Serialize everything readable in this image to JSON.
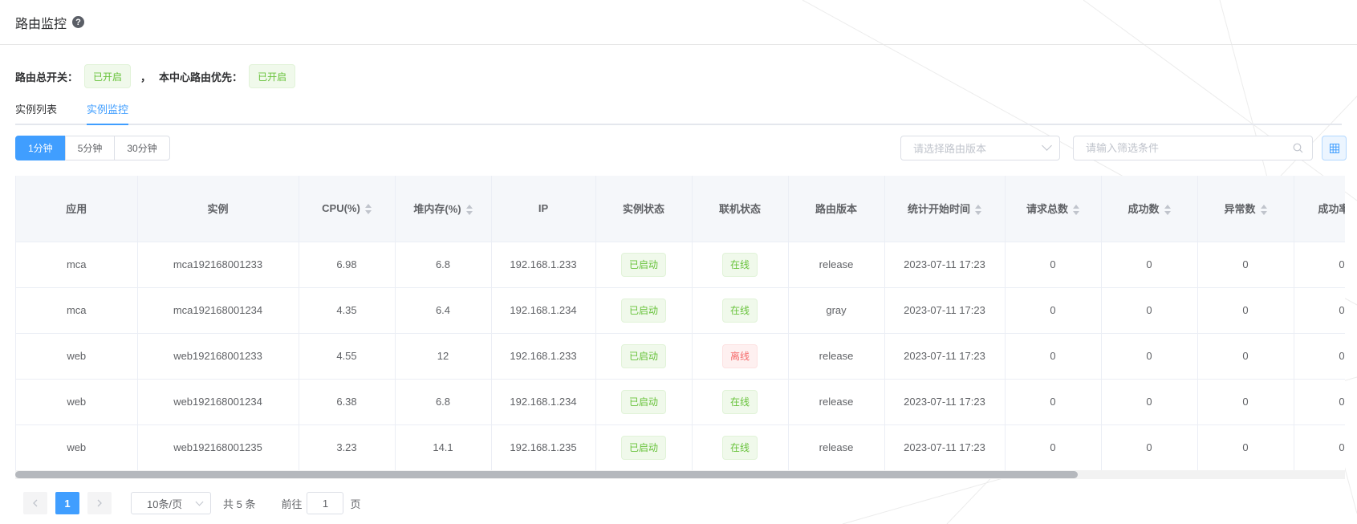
{
  "header": {
    "title": "路由监控",
    "help_icon": "question-circle-icon"
  },
  "switches": {
    "master_label": "路由总开关：",
    "master_value": "已开启",
    "separator": "，",
    "priority_label": "本中心路由优先：",
    "priority_value": "已开启"
  },
  "tabs": [
    {
      "label": "实例列表",
      "active": false
    },
    {
      "label": "实例监控",
      "active": true
    }
  ],
  "time_buttons": [
    {
      "label": "1分钟",
      "active": true
    },
    {
      "label": "5分钟",
      "active": false
    },
    {
      "label": "30分钟",
      "active": false
    }
  ],
  "filters": {
    "version_placeholder": "请选择路由版本",
    "search_placeholder": "请输入筛选条件"
  },
  "table": {
    "columns": [
      {
        "label": "应用",
        "sortable": false
      },
      {
        "label": "实例",
        "sortable": false
      },
      {
        "label": "CPU(%)",
        "sortable": true
      },
      {
        "label": "堆内存(%)",
        "sortable": true
      },
      {
        "label": "IP",
        "sortable": false
      },
      {
        "label": "实例状态",
        "sortable": false
      },
      {
        "label": "联机状态",
        "sortable": false
      },
      {
        "label": "路由版本",
        "sortable": false
      },
      {
        "label": "统计开始时间",
        "sortable": true
      },
      {
        "label": "请求总数",
        "sortable": true
      },
      {
        "label": "成功数",
        "sortable": true
      },
      {
        "label": "异常数",
        "sortable": true
      },
      {
        "label": "成功率(%)",
        "sortable": false
      }
    ],
    "rows": [
      {
        "app": "mca",
        "instance": "mca192168001233",
        "cpu": "6.98",
        "heap": "6.8",
        "ip": "192.168.1.233",
        "instance_status": "已启动",
        "online_status": "在线",
        "online_ok": true,
        "version": "release",
        "start_time": "2023-07-11 17:23",
        "total": "0",
        "success": "0",
        "error": "0",
        "rate": "0"
      },
      {
        "app": "mca",
        "instance": "mca192168001234",
        "cpu": "4.35",
        "heap": "6.4",
        "ip": "192.168.1.234",
        "instance_status": "已启动",
        "online_status": "在线",
        "online_ok": true,
        "version": "gray",
        "start_time": "2023-07-11 17:23",
        "total": "0",
        "success": "0",
        "error": "0",
        "rate": "0"
      },
      {
        "app": "web",
        "instance": "web192168001233",
        "cpu": "4.55",
        "heap": "12",
        "ip": "192.168.1.233",
        "instance_status": "已启动",
        "online_status": "离线",
        "online_ok": false,
        "version": "release",
        "start_time": "2023-07-11 17:23",
        "total": "0",
        "success": "0",
        "error": "0",
        "rate": "0"
      },
      {
        "app": "web",
        "instance": "web192168001234",
        "cpu": "6.38",
        "heap": "6.8",
        "ip": "192.168.1.234",
        "instance_status": "已启动",
        "online_status": "在线",
        "online_ok": true,
        "version": "release",
        "start_time": "2023-07-11 17:23",
        "total": "0",
        "success": "0",
        "error": "0",
        "rate": "0"
      },
      {
        "app": "web",
        "instance": "web192168001235",
        "cpu": "3.23",
        "heap": "14.1",
        "ip": "192.168.1.235",
        "instance_status": "已启动",
        "online_status": "在线",
        "online_ok": true,
        "version": "release",
        "start_time": "2023-07-11 17:23",
        "total": "0",
        "success": "0",
        "error": "0",
        "rate": "0"
      }
    ]
  },
  "pagination": {
    "current_page": "1",
    "page_size": "10条/页",
    "total": "共 5 条",
    "goto_label": "前往",
    "goto_value": "1",
    "page_suffix": "页"
  },
  "colors": {
    "primary": "#409eff",
    "success": "#67c23a",
    "danger": "#f56c6c"
  }
}
